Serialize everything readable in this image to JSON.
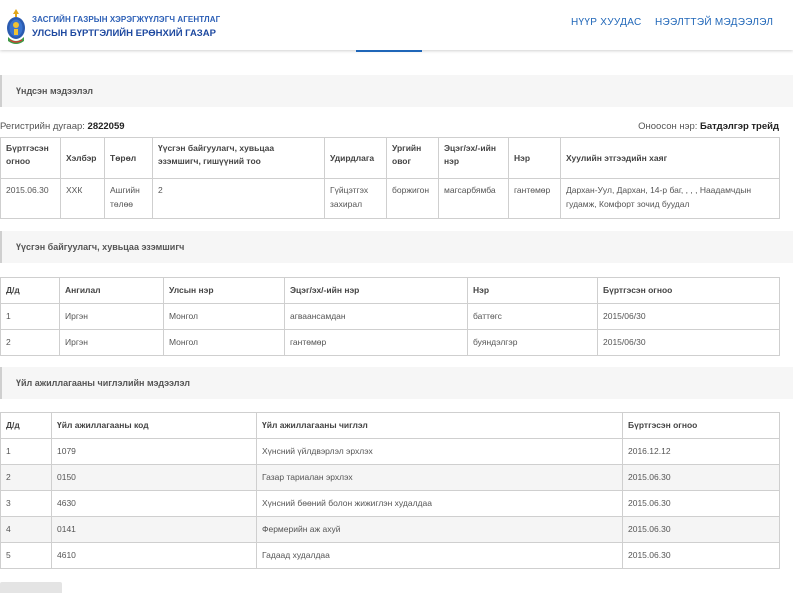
{
  "header": {
    "agency_top": "ЗАСГИЙН ГАЗРЫН ХЭРЭГЖҮҮЛЭГЧ АГЕНТЛАГ",
    "agency_main": "УЛСЫН БҮРТГЭЛИЙН ЕРӨНХИЙ ГАЗАР",
    "nav": [
      {
        "label": "НҮҮР ХУУДАС"
      },
      {
        "label": "НЭЭЛТТЭЙ МЭДЭЭЛЭЛ"
      }
    ]
  },
  "colors": {
    "accent": "#1f66b8",
    "brand": "#1e49a0",
    "header_text": "#2c5fb6",
    "section_bg": "#f6f6f6",
    "border": "#cfcfcf"
  },
  "basic": {
    "title": "Үндсэн мэдээлэл",
    "reg_label": "Регистрийн дугаар:",
    "reg_value": "2822059",
    "name_label": "Оноосон нэр:",
    "name_value": "Батдэлгэр трейд",
    "columns": [
      "Бүртгэсэн огноо",
      "Хэлбэр",
      "Төрөл",
      "Үүсгэн байгуулагч, хувьцаа эзэмшигч, гишүүний тоо",
      "Удирдлага",
      "Ургийн овог",
      "Эцэг/эх/-ийн нэр",
      "Нэр",
      "Хуулийн этгээдийн хаяг"
    ],
    "row": [
      "2015.06.30",
      "ХХК",
      "Ашгийн төлөө",
      "2",
      "Гүйцэтгэх захирал",
      "боржигон",
      "магсарбямба",
      "гантөмөр",
      "Дархан-Уул, Дархан, 14-р баг, , , , Наадамчдын гудамж, Комфорт зочид буудал"
    ]
  },
  "founders": {
    "title": "Үүсгэн байгуулагч, хувьцаа эзэмшигч",
    "columns": [
      "Д/д",
      "Ангилал",
      "Улсын нэр",
      "Эцэг/эх/-ийн нэр",
      "Нэр",
      "Бүртгэсэн огноо"
    ],
    "rows": [
      [
        "1",
        "Иргэн",
        "Монгол",
        "агваансамдан",
        "баттөгс",
        "2015/06/30"
      ],
      [
        "2",
        "Иргэн",
        "Монгол",
        "гантөмөр",
        "буяндэлгэр",
        "2015/06/30"
      ]
    ]
  },
  "activities": {
    "title": "Үйл ажиллагааны чиглэлийн мэдээлэл",
    "columns": [
      "Д/д",
      "Үйл ажиллагааны код",
      "Үйл ажиллагааны чиглэл",
      "Бүртгэсэн огноо"
    ],
    "rows": [
      [
        "1",
        "1079",
        "Хүнсний үйлдвэрлэл эрхлэх",
        "2016.12.12"
      ],
      [
        "2",
        "0150",
        "Газар тариалан эрхлэх",
        "2015.06.30"
      ],
      [
        "3",
        "4630",
        "Хүнсний бөөний болон жижиглэн худалдаа",
        "2015.06.30"
      ],
      [
        "4",
        "0141",
        "Фермерийн аж ахуй",
        "2015.06.30"
      ],
      [
        "5",
        "4610",
        "Гадаад худалдаа",
        "2015.06.30"
      ]
    ]
  },
  "icons": [
    "coat-of-arms-logo"
  ]
}
